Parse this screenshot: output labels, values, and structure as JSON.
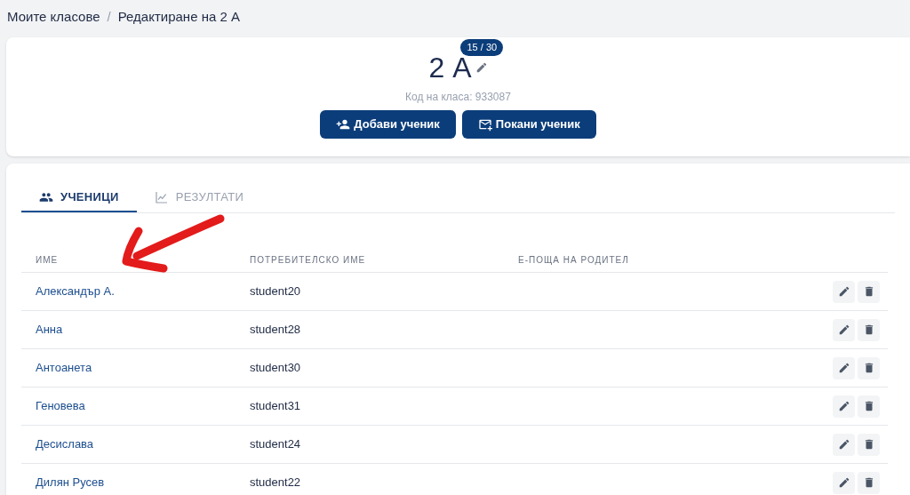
{
  "breadcrumb_separator": "/",
  "breadcrumb": [
    {
      "label": "Моите класове"
    },
    {
      "label": "Редактиране на 2 А"
    }
  ],
  "class": {
    "name": "2 А",
    "count": "15 / 30",
    "code": "Код на класа: 933087"
  },
  "actions": [
    {
      "kind": "add",
      "label": "Добави ученик"
    },
    {
      "kind": "invite",
      "label": "Покани ученик"
    }
  ],
  "tabs": [
    {
      "kind": "students",
      "label": "УЧЕНИЦИ",
      "selected": true
    },
    {
      "kind": "results",
      "label": "РЕЗУЛТАТИ",
      "selected": false
    }
  ],
  "table": {
    "columns": [
      "ИМЕ",
      "ПОТРЕБИТЕЛСКО ИМЕ",
      "Е-ПОЩА НА РОДИТЕЛ"
    ],
    "rows": [
      {
        "name": "Александър А.",
        "username": "student20"
      },
      {
        "name": "Анна",
        "username": "student28"
      },
      {
        "name": "Антоанета",
        "username": "student30"
      },
      {
        "name": "Геновева",
        "username": "student31"
      },
      {
        "name": "Десислава",
        "username": "student24"
      },
      {
        "name": "Дилян Русев",
        "username": "student22"
      }
    ]
  }
}
